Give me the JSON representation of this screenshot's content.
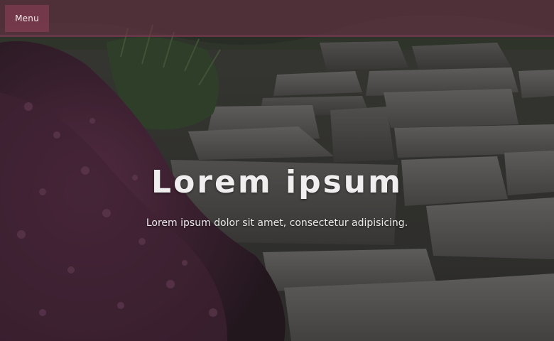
{
  "header": {
    "menu_label": "Menu",
    "bar_color": "#683244"
  },
  "hero": {
    "title": "Lorem ipsum",
    "subtitle": "Lorem ipsum dolor sit amet, consectetur adipisicing.",
    "background_image": "stone-path-with-heather",
    "text_color": "#f1eef0"
  }
}
